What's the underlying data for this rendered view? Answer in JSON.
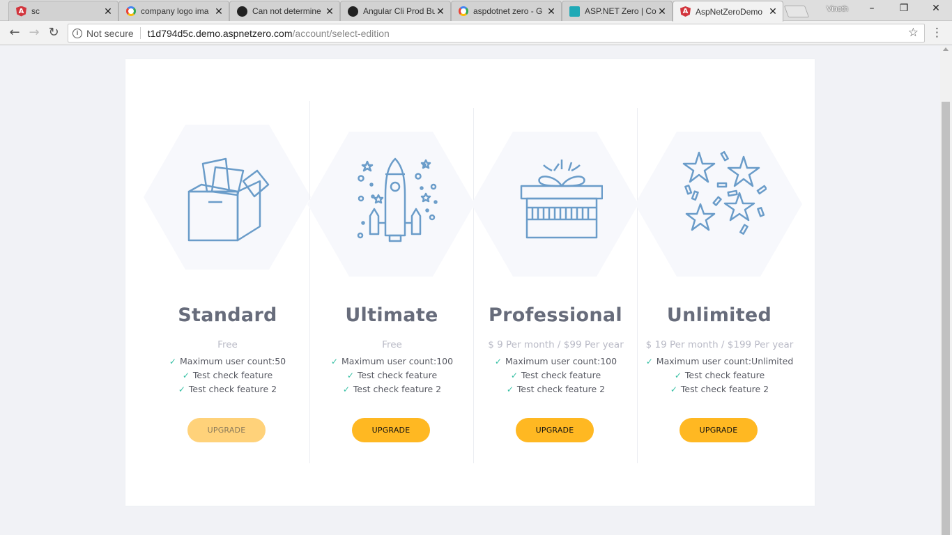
{
  "browser": {
    "tabs": [
      {
        "label": "sc",
        "icon": "angular-icon",
        "active": false
      },
      {
        "label": "company logo ima",
        "icon": "google-icon",
        "active": false
      },
      {
        "label": "Can not determine",
        "icon": "github-icon",
        "active": false
      },
      {
        "label": "Angular Cli Prod Bu",
        "icon": "github-icon",
        "active": false
      },
      {
        "label": "aspdotnet zero - G",
        "icon": "google-icon",
        "active": false
      },
      {
        "label": "ASP.NET Zero | Co",
        "icon": "aspnetzero-icon",
        "active": false
      },
      {
        "label": "AspNetZeroDemo",
        "icon": "angular-icon",
        "active": true
      }
    ],
    "profile_name": "Vinoth",
    "close_glyph": "✕",
    "security_label": "Not secure",
    "url_host": "t1d794d5c.demo.aspnetzero.com",
    "url_path": "/account/select-edition"
  },
  "editions": [
    {
      "name": "Standard",
      "price": "Free",
      "illustration": "open-box-icon",
      "features": [
        "Maximum user count:50",
        "Test check feature",
        "Test check feature 2"
      ],
      "button": "UPGRADE",
      "button_enabled": false
    },
    {
      "name": "Ultimate",
      "price": "Free",
      "illustration": "rocket-icon",
      "features": [
        "Maximum user count:100",
        "Test check feature",
        "Test check feature 2"
      ],
      "button": "UPGRADE",
      "button_enabled": true
    },
    {
      "name": "Professional",
      "price": "$ 9 Per month / $99 Per year",
      "illustration": "gift-icon",
      "features": [
        "Maximum user count:100",
        "Test check feature",
        "Test check feature 2"
      ],
      "button": "UPGRADE",
      "button_enabled": true
    },
    {
      "name": "Unlimited",
      "price": "$ 19 Per month / $199 Per year",
      "illustration": "stars-confetti-icon",
      "features": [
        "Maximum user count:Unlimited",
        "Test check feature",
        "Test check feature 2"
      ],
      "button": "UPGRADE",
      "button_enabled": true
    }
  ],
  "colors": {
    "accent": "#ffb822",
    "check": "#34bfa3",
    "illustration_stroke": "#6a9cc9"
  }
}
